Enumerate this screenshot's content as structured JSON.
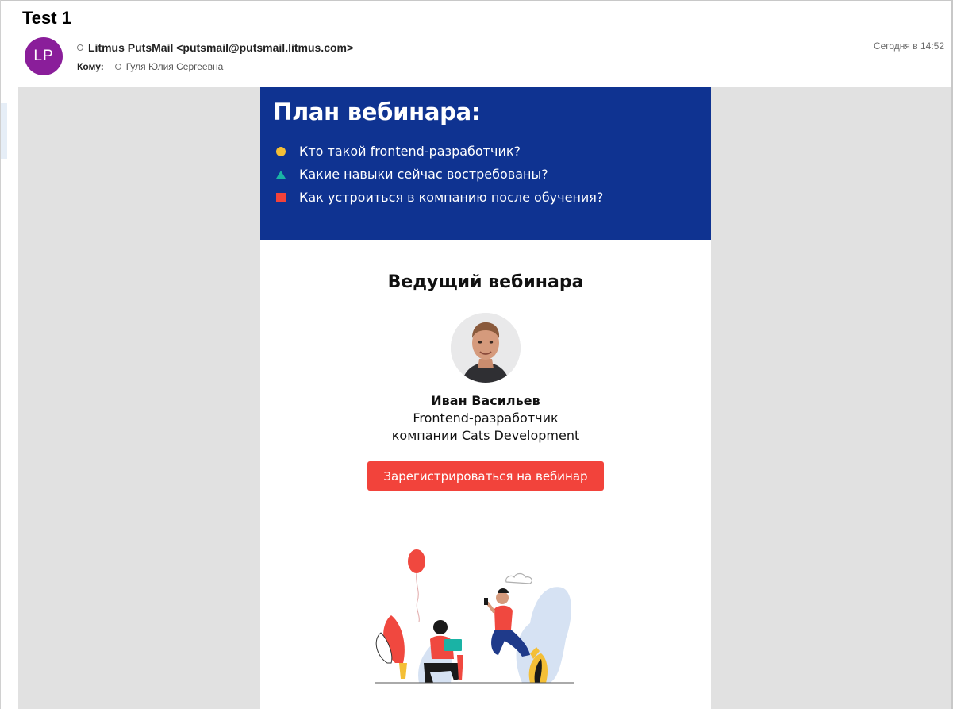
{
  "message": {
    "subject": "Test 1",
    "avatar_initials": "LP",
    "avatar_color": "#8a1e9a",
    "from": "Litmus PutsMail <putsmail@putsmail.litmus.com>",
    "to_label": "Кому:",
    "to": "Гуля Юлия Сергеевна",
    "timestamp": "Сегодня в 14:52"
  },
  "email": {
    "plan": {
      "title": "План вебинара:",
      "background": "#0f3391",
      "items": [
        {
          "bullet": "yellow-circle",
          "text": "Кто такой frontend-разработчик?"
        },
        {
          "bullet": "teal-triangle",
          "text": "Какие навыки сейчас востребованы?"
        },
        {
          "bullet": "red-square",
          "text": "Как устроиться в компанию после обучения?"
        }
      ]
    },
    "host": {
      "heading": "Ведущий вебинара",
      "name": "Иван Васильев",
      "role_line1": "Frontend-разработчик",
      "role_line2": "компании Cats Development"
    },
    "cta": {
      "label": "Зарегистрироваться на вебинар",
      "color": "#f2433b"
    }
  }
}
